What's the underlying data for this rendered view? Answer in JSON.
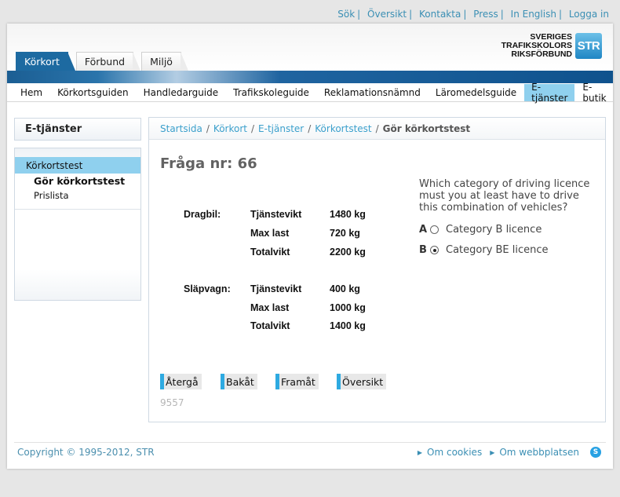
{
  "top_links": [
    "Sök",
    "Översikt",
    "Kontakta",
    "Press",
    "In English",
    "Logga in"
  ],
  "logo": {
    "line1": "SVERIGES",
    "line2": "TRAFIKSKOLORS",
    "line3": "RIKSFÖRBUND",
    "mark": "STR"
  },
  "top_tabs": [
    "Körkort",
    "Förbund",
    "Miljö"
  ],
  "nav": [
    "Hem",
    "Körkortsguiden",
    "Handledarguide",
    "Trafikskoleguide",
    "Reklamationsnämnd",
    "Läromedelsguide",
    "E-tjänster",
    "E-butik"
  ],
  "sidebar": {
    "title": "E-tjänster",
    "active": "Körkortstest",
    "sub1": "Gör körkortstest",
    "sub2": "Prislista"
  },
  "breadcrumb": [
    "Startsida",
    "Körkort",
    "E-tjänster",
    "Körkortstest"
  ],
  "breadcrumb_current": "Gör körkortstest",
  "question": {
    "title": "Fråga nr: 66",
    "text": "Which category of driving licence must you at least have to drive this combination of vehicles?",
    "options": [
      {
        "letter": "A",
        "label": "Category B licence",
        "selected": false
      },
      {
        "letter": "B",
        "label": "Category BE licence",
        "selected": true
      }
    ],
    "id": "9557"
  },
  "vehicles": {
    "towing": {
      "label": "Dragbil:",
      "rows": [
        {
          "k": "Tjänstevikt",
          "v": "1480 kg"
        },
        {
          "k": "Max last",
          "v": "720 kg"
        },
        {
          "k": "Totalvikt",
          "v": "2200 kg"
        }
      ]
    },
    "trailer": {
      "label": "Släpvagn:",
      "rows": [
        {
          "k": "Tjänstevikt",
          "v": "400 kg"
        },
        {
          "k": "Max last",
          "v": "1000 kg"
        },
        {
          "k": "Totalvikt",
          "v": "1400 kg"
        }
      ]
    }
  },
  "buttons": {
    "back_to": "Återgå",
    "prev": "Bakåt",
    "next": "Framåt",
    "overview": "Översikt"
  },
  "footer": {
    "copyright": "Copyright © 1995-2012, STR",
    "cookies": "Om cookies",
    "about": "Om webbplatsen"
  },
  "colors": {
    "nav_active": "#8fd0ee",
    "brand_blue": "#1d6aa1",
    "link": "#3ba0cc"
  }
}
